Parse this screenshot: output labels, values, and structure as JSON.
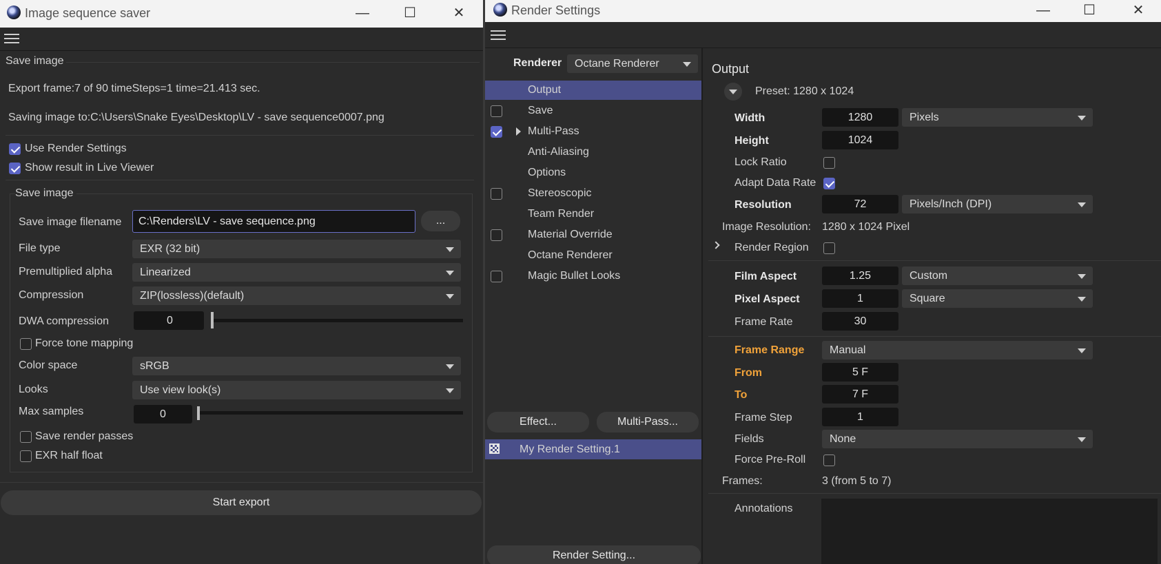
{
  "left_window": {
    "title": "Image sequence saver",
    "window_controls": {
      "minimize": "—",
      "maximize": "☐",
      "close": "✕"
    },
    "section_title": "Save image",
    "export_status": "Export frame:7 of 90  timeSteps=1  time=21.413 sec.",
    "saving_path": "Saving image to:C:\\Users\\Snake Eyes\\Desktop\\LV - save sequence0007.png",
    "use_render_settings": {
      "label": "Use Render Settings",
      "checked": true
    },
    "show_result": {
      "label": "Show result in Live Viewer",
      "checked": true
    },
    "group_title": "Save image",
    "filename": {
      "label": "Save image filename",
      "value": "C:\\Renders\\LV - save sequence.png",
      "browse": "..."
    },
    "file_type": {
      "label": "File type",
      "value": "EXR (32 bit)"
    },
    "premultiplied_alpha": {
      "label": "Premultiplied alpha",
      "value": "Linearized"
    },
    "compression": {
      "label": "Compression",
      "value": "ZIP(lossless)(default)"
    },
    "dwa_compression": {
      "label": "DWA compression",
      "value": "0",
      "level": 0
    },
    "force_tone_mapping": {
      "label": "Force tone mapping",
      "checked": false
    },
    "color_space": {
      "label": "Color space",
      "value": "sRGB"
    },
    "looks": {
      "label": "Looks",
      "value": "Use view look(s)"
    },
    "max_samples": {
      "label": "Max samples",
      "value": "0",
      "level": 0
    },
    "save_render_passes": {
      "label": "Save render passes",
      "checked": false
    },
    "exr_half_float": {
      "label": "EXR half float",
      "checked": false
    },
    "start_export": "Start export"
  },
  "right_window": {
    "title": "Render Settings",
    "window_controls": {
      "minimize": "—",
      "maximize": "☐",
      "close": "✕"
    },
    "renderer_label": "Renderer",
    "renderer_value": "Octane Renderer",
    "nav": [
      {
        "label": "Output",
        "checkbox": null,
        "selected": true
      },
      {
        "label": "Save",
        "checkbox": false
      },
      {
        "label": "Multi-Pass",
        "checkbox": true,
        "expandable": true
      },
      {
        "label": "Anti-Aliasing",
        "checkbox": null
      },
      {
        "label": "Options",
        "checkbox": null
      },
      {
        "label": "Stereoscopic",
        "checkbox": false
      },
      {
        "label": "Team Render",
        "checkbox": null
      },
      {
        "label": "Material Override",
        "checkbox": false
      },
      {
        "label": "Octane Renderer",
        "checkbox": null
      },
      {
        "label": "Magic Bullet Looks",
        "checkbox": false
      }
    ],
    "effect_button": "Effect...",
    "multipass_button": "Multi-Pass...",
    "render_setting_item": "My Render Setting.1",
    "render_setting_button": "Render Setting...",
    "output": {
      "heading": "Output",
      "preset": "Preset: 1280 x 1024",
      "width": {
        "label": "Width",
        "value": "1280",
        "unit": "Pixels"
      },
      "height": {
        "label": "Height",
        "value": "1024"
      },
      "lock_ratio": {
        "label": "Lock Ratio",
        "checked": false
      },
      "adapt_data_rate": {
        "label": "Adapt Data Rate",
        "checked": true
      },
      "resolution": {
        "label": "Resolution",
        "value": "72",
        "unit": "Pixels/Inch (DPI)"
      },
      "image_resolution": {
        "label": "Image Resolution:",
        "value": "1280 x 1024 Pixel"
      },
      "render_region": {
        "label": "Render Region",
        "checked": false
      },
      "film_aspect": {
        "label": "Film Aspect",
        "value": "1.25",
        "unit": "Custom"
      },
      "pixel_aspect": {
        "label": "Pixel Aspect",
        "value": "1",
        "unit": "Square"
      },
      "frame_rate": {
        "label": "Frame Rate",
        "value": "30"
      },
      "frame_range": {
        "label": "Frame Range",
        "value": "Manual"
      },
      "from": {
        "label": "From",
        "value": "5 F"
      },
      "to": {
        "label": "To",
        "value": "7 F"
      },
      "frame_step": {
        "label": "Frame Step",
        "value": "1"
      },
      "fields": {
        "label": "Fields",
        "value": "None"
      },
      "force_preroll": {
        "label": "Force Pre-Roll",
        "checked": false
      },
      "frames": {
        "label": "Frames:",
        "value": "3 (from 5 to 7)"
      },
      "annotations": {
        "label": "Annotations",
        "value": ""
      }
    }
  },
  "colors": {
    "accent": "#5b64c4",
    "orange": "#f0a23a",
    "panel": "#2a2a2a",
    "titlebar": "#f3f3f3"
  }
}
